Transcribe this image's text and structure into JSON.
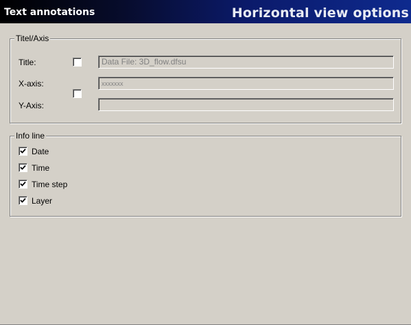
{
  "header": {
    "title": "Text annotations",
    "subtitle": "Horizontal view options"
  },
  "title_axis": {
    "legend": "Titel/Axis",
    "title_label": "Title:",
    "title_checked": false,
    "title_value": "Data File: 3D_flow.dfsu",
    "xaxis_label": "X-axis:",
    "xaxis_value": "xxxxxxx",
    "yaxis_label": "Y-Axis:",
    "yaxis_value": "",
    "axis_checked": false
  },
  "info_line": {
    "legend": "Info line",
    "items": [
      {
        "label": "Date",
        "checked": true
      },
      {
        "label": "Time",
        "checked": true
      },
      {
        "label": "Time step",
        "checked": true
      },
      {
        "label": "Layer",
        "checked": true
      }
    ]
  }
}
